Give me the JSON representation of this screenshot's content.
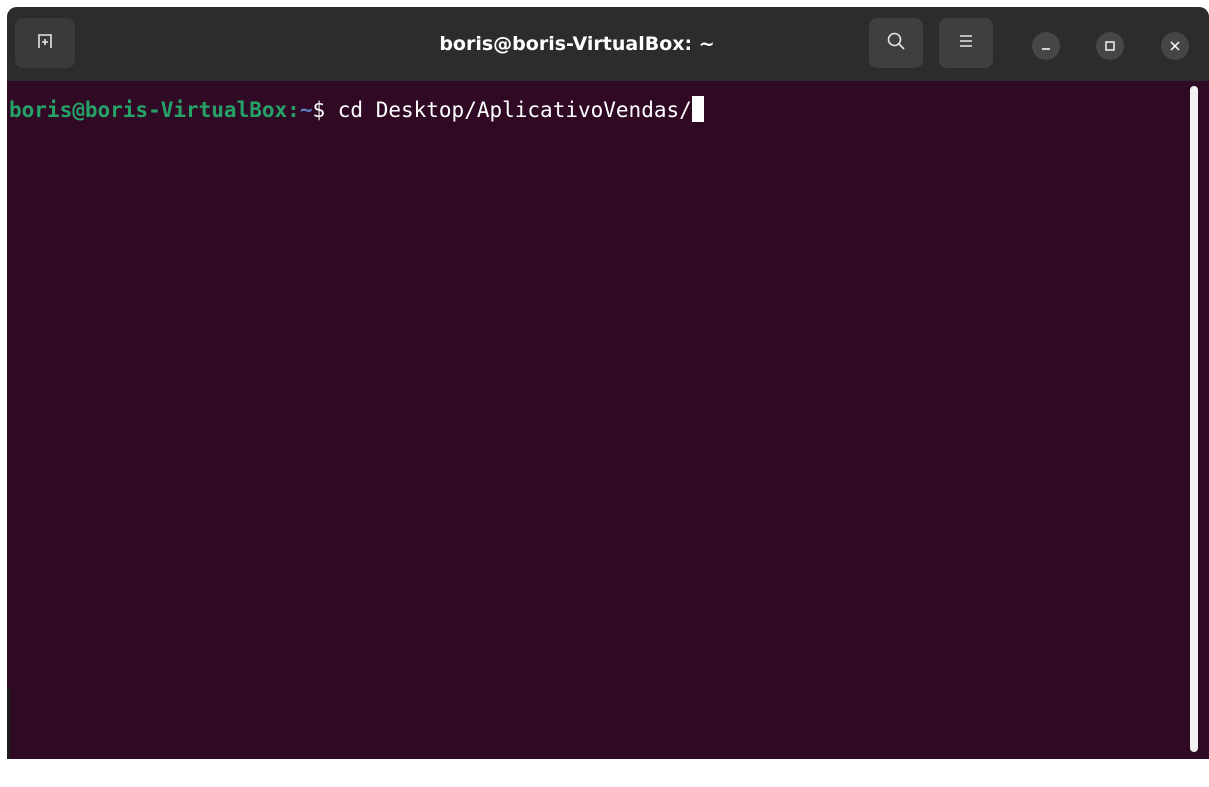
{
  "window": {
    "title": "boris@boris-VirtualBox: ~",
    "background_color": "#300a24",
    "titlebar_color": "#2c2c2c"
  },
  "titlebar": {
    "new_tab_icon": "new-tab-icon",
    "search_icon": "search-icon",
    "menu_icon": "hamburger-menu-icon",
    "minimize_icon": "minimize-icon",
    "maximize_icon": "maximize-icon",
    "close_icon": "close-icon"
  },
  "terminal": {
    "prompt_user_host": "boris@boris-VirtualBox",
    "prompt_separator": ":",
    "prompt_path": "~",
    "prompt_symbol": "$ ",
    "command": "cd Desktop/AplicativoVendas/",
    "user_host_color": "#26a269",
    "path_color": "#5d7bbf",
    "text_color": "#ffffff"
  }
}
